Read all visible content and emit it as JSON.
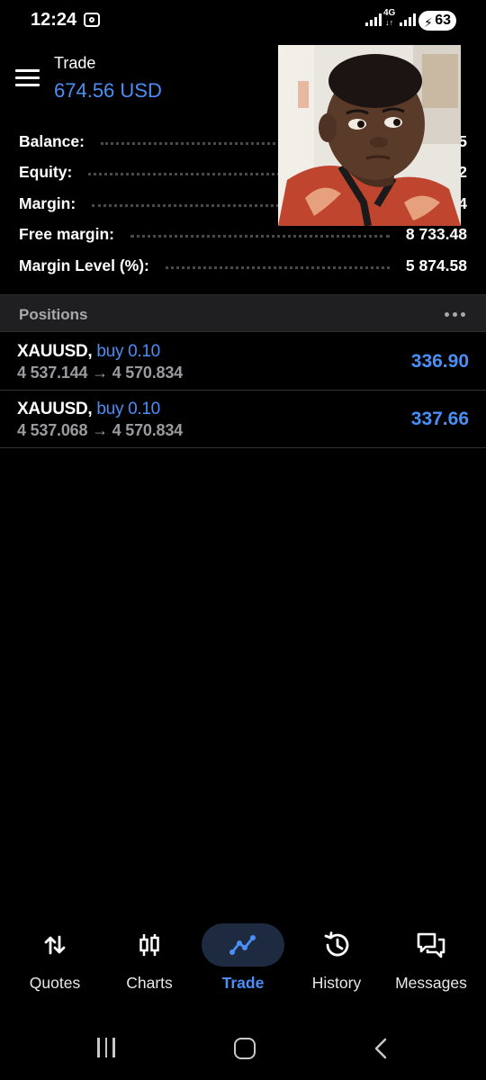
{
  "status_bar": {
    "time": "12:24",
    "network": "4G",
    "battery": "63"
  },
  "header": {
    "title": "Trade",
    "balance_display": "674.56 USD"
  },
  "summary": [
    {
      "label": "Balance:",
      "value": "5"
    },
    {
      "label": "Equity:",
      "value": "2"
    },
    {
      "label": "Margin:",
      "value": "4"
    },
    {
      "label": "Free margin:",
      "value": "8 733.48"
    },
    {
      "label": "Margin Level (%):",
      "value": "5 874.58"
    }
  ],
  "positions": {
    "title": "Positions",
    "items": [
      {
        "symbol": "XAUUSD,",
        "side": "buy 0.10",
        "prices": "4 537.144 → 4 570.834",
        "profit": "336.90"
      },
      {
        "symbol": "XAUUSD,",
        "side": "buy 0.10",
        "prices": "4 537.068 → 4 570.834",
        "profit": "337.66"
      }
    ]
  },
  "bottom_nav": [
    {
      "label": "Quotes",
      "icon": "quotes-arrows-icon",
      "active": false
    },
    {
      "label": "Charts",
      "icon": "candlestick-icon",
      "active": false
    },
    {
      "label": "Trade",
      "icon": "trade-line-icon",
      "active": true
    },
    {
      "label": "History",
      "icon": "history-clock-icon",
      "active": false
    },
    {
      "label": "Messages",
      "icon": "messages-chat-icon",
      "active": false
    }
  ],
  "colors": {
    "accent": "#4b8ef5",
    "background": "#000000",
    "section_header": "#1f1f21",
    "muted_text": "#9a9aa0"
  }
}
